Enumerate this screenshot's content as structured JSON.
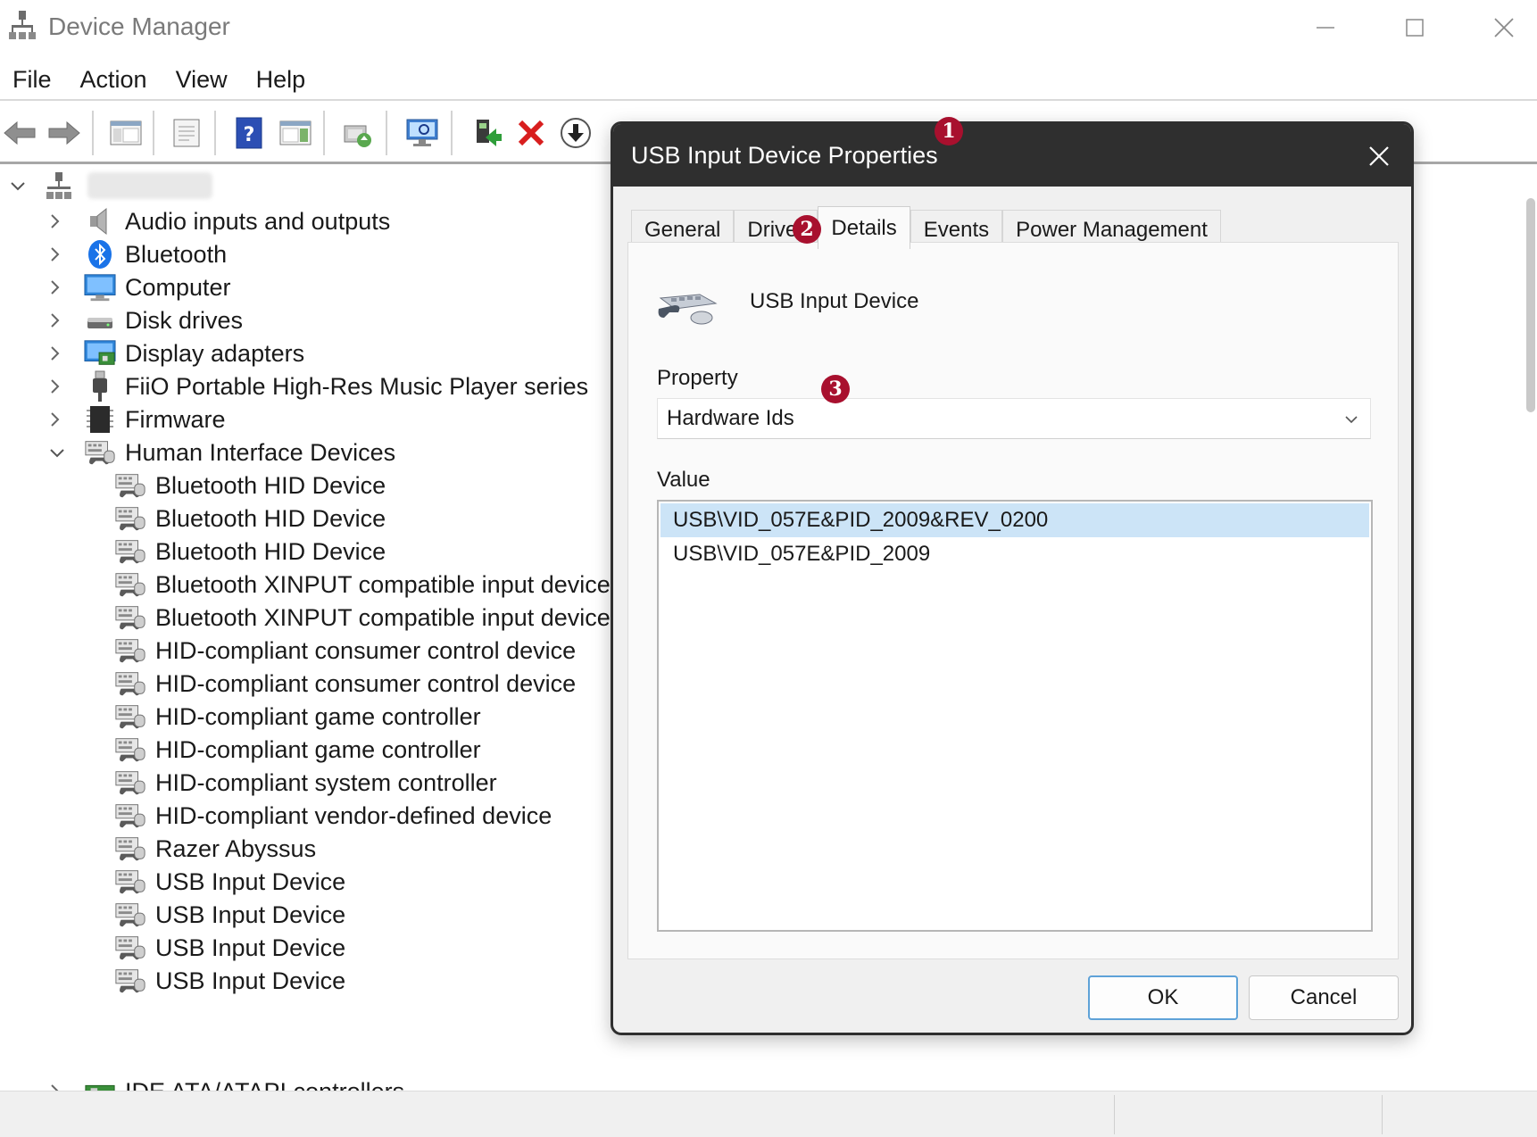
{
  "window": {
    "title": "Device Manager",
    "controls": {
      "minimize_icon": "minimize-icon",
      "maximize_icon": "maximize-icon",
      "close_icon": "close-icon"
    }
  },
  "menu": [
    {
      "label": "File"
    },
    {
      "label": "Action"
    },
    {
      "label": "View"
    },
    {
      "label": "Help"
    }
  ],
  "toolbar": {
    "buttons": [
      "back-icon",
      "forward-icon",
      "show-hide-console-tree-icon",
      "properties-icon",
      "help-icon",
      "action-pane-icon",
      "update-driver-icon",
      "scan-hardware-icon",
      "enable-device-icon",
      "uninstall-device-icon",
      "disable-device-icon"
    ]
  },
  "tree": {
    "root_label": "",
    "categories": [
      {
        "label": "Audio inputs and outputs",
        "icon": "speaker-icon"
      },
      {
        "label": "Bluetooth",
        "icon": "bluetooth-icon"
      },
      {
        "label": "Computer",
        "icon": "computer-icon"
      },
      {
        "label": "Disk drives",
        "icon": "disk-drive-icon"
      },
      {
        "label": "Display adapters",
        "icon": "display-adapter-icon"
      },
      {
        "label": "FiiO Portable High-Res Music Player series",
        "icon": "usb-plug-icon"
      },
      {
        "label": "Firmware",
        "icon": "firmware-chip-icon"
      },
      {
        "label": "Human Interface Devices",
        "icon": "hid-icon",
        "expanded": true
      }
    ],
    "hid_children": [
      "Bluetooth HID Device",
      "Bluetooth HID Device",
      "Bluetooth HID Device",
      "Bluetooth XINPUT compatible input device",
      "Bluetooth XINPUT compatible input device",
      "HID-compliant consumer control device",
      "HID-compliant consumer control device",
      "HID-compliant game controller",
      "HID-compliant game controller",
      "HID-compliant system controller",
      "HID-compliant vendor-defined device",
      "Razer Abyssus",
      "USB Input Device",
      "USB Input Device",
      "USB Input Device",
      "USB Input Device"
    ],
    "after": [
      {
        "label": "IDE ATA/ATAPI controllers",
        "icon": "ide-controller-icon"
      }
    ]
  },
  "dialog": {
    "title": "USB Input Device Properties",
    "tabs": [
      {
        "label": "General",
        "active": false
      },
      {
        "label": "Driver",
        "active": false
      },
      {
        "label": "Details",
        "active": true
      },
      {
        "label": "Events",
        "active": false
      },
      {
        "label": "Power Management",
        "active": false
      }
    ],
    "device_name": "USB Input Device",
    "property_label": "Property",
    "property_value": "Hardware Ids",
    "value_label": "Value",
    "values": [
      {
        "text": "USB\\VID_057E&PID_2009&REV_0200",
        "selected": true
      },
      {
        "text": "USB\\VID_057E&PID_2009",
        "selected": false
      }
    ],
    "ok_label": "OK",
    "cancel_label": "Cancel"
  },
  "callouts": [
    "1",
    "2",
    "3"
  ],
  "colors": {
    "callout": "#a8102e",
    "selection": "#cce4f7",
    "dialog_title_bg": "#2f2f2f",
    "ok_border": "#5ea2d8"
  }
}
